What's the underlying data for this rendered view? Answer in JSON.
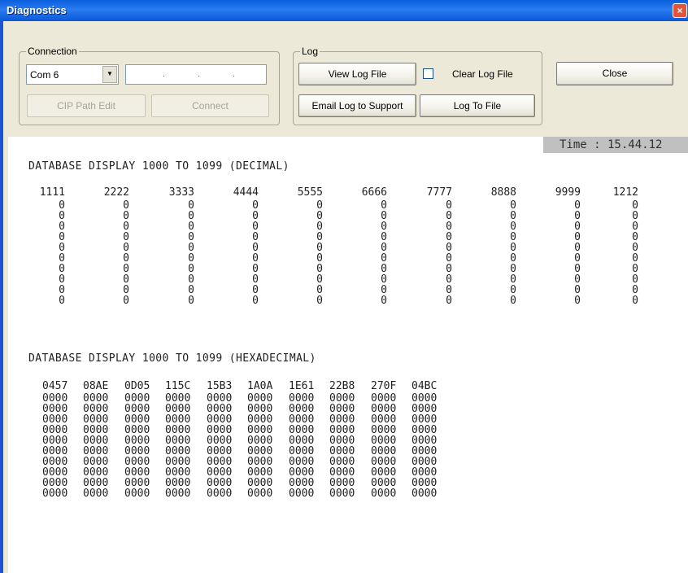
{
  "window": {
    "title": "Diagnostics",
    "close_glyph": "×"
  },
  "connection": {
    "label": "Connection",
    "port": "Com 6",
    "ip_dots": [
      ".",
      ".",
      "."
    ],
    "cip_button": "CIP Path Edit",
    "connect_button": "Connect"
  },
  "log": {
    "label": "Log",
    "view_button": "View Log File",
    "clear_label": "Clear Log File",
    "email_button": "Email Log to Support",
    "to_file_button": "Log To File"
  },
  "close_button": "Close",
  "time": "Time : 15.44.12",
  "decimal": {
    "heading": "DATABASE DISPLAY 1000 TO 1099 (DECIMAL)",
    "rows": [
      [
        "1111",
        "2222",
        "3333",
        "4444",
        "5555",
        "6666",
        "7777",
        "8888",
        "9999",
        "1212"
      ],
      [
        "0",
        "0",
        "0",
        "0",
        "0",
        "0",
        "0",
        "0",
        "0",
        "0"
      ],
      [
        "0",
        "0",
        "0",
        "0",
        "0",
        "0",
        "0",
        "0",
        "0",
        "0"
      ],
      [
        "0",
        "0",
        "0",
        "0",
        "0",
        "0",
        "0",
        "0",
        "0",
        "0"
      ],
      [
        "0",
        "0",
        "0",
        "0",
        "0",
        "0",
        "0",
        "0",
        "0",
        "0"
      ],
      [
        "0",
        "0",
        "0",
        "0",
        "0",
        "0",
        "0",
        "0",
        "0",
        "0"
      ],
      [
        "0",
        "0",
        "0",
        "0",
        "0",
        "0",
        "0",
        "0",
        "0",
        "0"
      ],
      [
        "0",
        "0",
        "0",
        "0",
        "0",
        "0",
        "0",
        "0",
        "0",
        "0"
      ],
      [
        "0",
        "0",
        "0",
        "0",
        "0",
        "0",
        "0",
        "0",
        "0",
        "0"
      ],
      [
        "0",
        "0",
        "0",
        "0",
        "0",
        "0",
        "0",
        "0",
        "0",
        "0"
      ],
      [
        "0",
        "0",
        "0",
        "0",
        "0",
        "0",
        "0",
        "0",
        "0",
        "0"
      ]
    ]
  },
  "hexadecimal": {
    "heading": "DATABASE DISPLAY 1000 TO 1099 (HEXADECIMAL)",
    "rows": [
      [
        "0457",
        "08AE",
        "0D05",
        "115C",
        "15B3",
        "1A0A",
        "1E61",
        "22B8",
        "270F",
        "04BC"
      ],
      [
        "0000",
        "0000",
        "0000",
        "0000",
        "0000",
        "0000",
        "0000",
        "0000",
        "0000",
        "0000"
      ],
      [
        "0000",
        "0000",
        "0000",
        "0000",
        "0000",
        "0000",
        "0000",
        "0000",
        "0000",
        "0000"
      ],
      [
        "0000",
        "0000",
        "0000",
        "0000",
        "0000",
        "0000",
        "0000",
        "0000",
        "0000",
        "0000"
      ],
      [
        "0000",
        "0000",
        "0000",
        "0000",
        "0000",
        "0000",
        "0000",
        "0000",
        "0000",
        "0000"
      ],
      [
        "0000",
        "0000",
        "0000",
        "0000",
        "0000",
        "0000",
        "0000",
        "0000",
        "0000",
        "0000"
      ],
      [
        "0000",
        "0000",
        "0000",
        "0000",
        "0000",
        "0000",
        "0000",
        "0000",
        "0000",
        "0000"
      ],
      [
        "0000",
        "0000",
        "0000",
        "0000",
        "0000",
        "0000",
        "0000",
        "0000",
        "0000",
        "0000"
      ],
      [
        "0000",
        "0000",
        "0000",
        "0000",
        "0000",
        "0000",
        "0000",
        "0000",
        "0000",
        "0000"
      ],
      [
        "0000",
        "0000",
        "0000",
        "0000",
        "0000",
        "0000",
        "0000",
        "0000",
        "0000",
        "0000"
      ],
      [
        "0000",
        "0000",
        "0000",
        "0000",
        "0000",
        "0000",
        "0000",
        "0000",
        "0000",
        "0000"
      ]
    ]
  }
}
